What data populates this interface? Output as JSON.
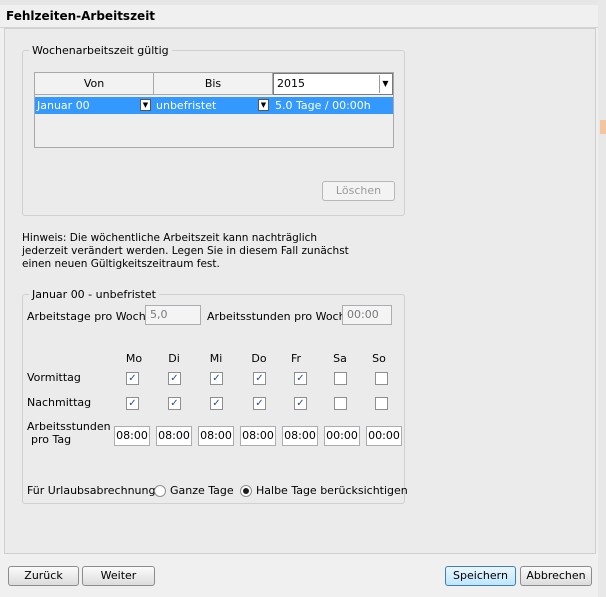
{
  "window": {
    "title": "Fehlzeiten-Arbeitszeit"
  },
  "validity": {
    "legend": "Wochenarbeitszeit gültig",
    "columns": [
      "Von",
      "Bis"
    ],
    "year": "2015",
    "row": {
      "von": "Januar 00",
      "bis": "unbefristet",
      "value": "5.0 Tage / 00:00h"
    },
    "delete_label": "Löschen"
  },
  "hint": "Hinweis: Die wöchentliche Arbeitszeit kann nachträglich jederzeit verändert werden. Legen Sie in diesem Fall zunächst einen neuen Gültigkeitszeitraum fest.",
  "period": {
    "legend": "Januar 00 - unbefristet",
    "workdays_label": "Arbeitstage pro Woche",
    "workdays_value": "5,0",
    "workhours_label": "Arbeitsstunden pro Woche",
    "workhours_value": "00:00",
    "days": [
      "Mo",
      "Di",
      "Mi",
      "Do",
      "Fr",
      "Sa",
      "So"
    ],
    "morning_label": "Vormittag",
    "afternoon_label": "Nachmittag",
    "hours_label_1": "Arbeitsstunden",
    "hours_label_2": "pro Tag",
    "morning": [
      true,
      true,
      true,
      true,
      true,
      false,
      false
    ],
    "afternoon": [
      true,
      true,
      true,
      true,
      true,
      false,
      false
    ],
    "hours": [
      "08:00",
      "08:00",
      "08:00",
      "08:00",
      "08:00",
      "00:00",
      "00:00"
    ],
    "vacation_label": "Für Urlaubsabrechnung:",
    "option_full": "Ganze Tage",
    "option_half": "Halbe Tage berücksichtigen",
    "selected_option": "half"
  },
  "footer": {
    "back": "Zurück",
    "next": "Weiter",
    "save": "Speichern",
    "cancel": "Abbrechen"
  }
}
